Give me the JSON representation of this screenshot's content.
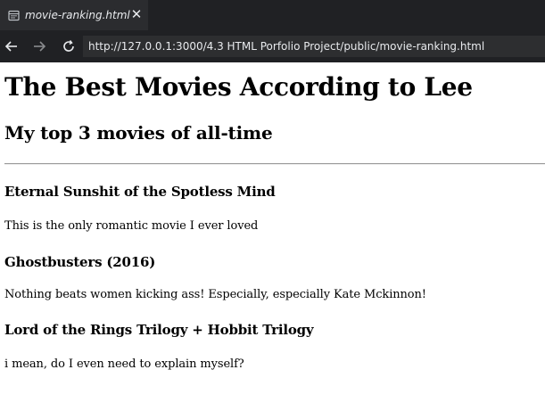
{
  "browser": {
    "tab": {
      "title": "movie-ranking.html",
      "icon": "page-icon",
      "close_icon": "close-icon",
      "close_glyph": "✕"
    },
    "toolbar": {
      "back_icon": "back-arrow-icon",
      "forward_icon": "forward-arrow-icon",
      "reload_icon": "reload-icon",
      "url": "http://127.0.0.1:3000/4.3 HTML Porfolio Project/public/movie-ranking.html"
    },
    "colors": {
      "chrome_background": "#202124",
      "tab_background": "#2b2c2f",
      "address_bar_background": "#2d2e30",
      "chrome_text": "#e8eaed"
    }
  },
  "page": {
    "heading": "The Best Movies According to Lee",
    "subheading": "My top 3 movies of all-time",
    "movies": [
      {
        "title": "Eternal Sunshit of the Spotless Mind",
        "description": "This is the only romantic movie I ever loved"
      },
      {
        "title": "Ghostbusters (2016)",
        "description": "Nothing beats women kicking ass! Especially, especially Kate Mckinnon!"
      },
      {
        "title": "Lord of the Rings Trilogy + Hobbit Trilogy",
        "description": "i mean, do I even need to explain myself?"
      }
    ]
  }
}
